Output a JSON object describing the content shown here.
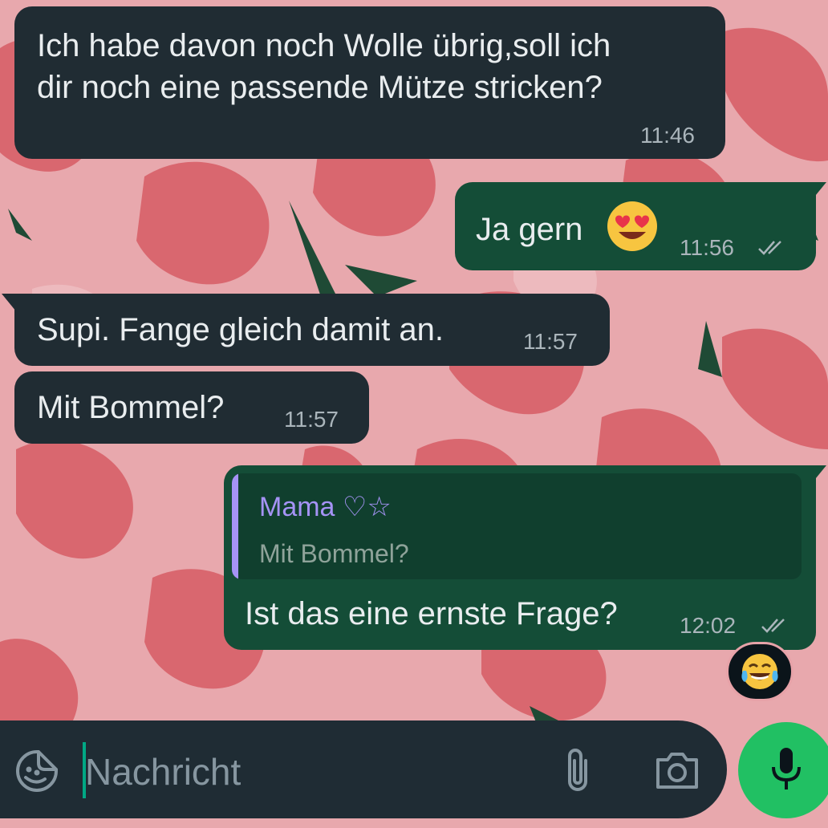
{
  "chat": {
    "messages": [
      {
        "direction": "incoming",
        "text_line1": "Ich habe davon noch Wolle übrig,soll ich",
        "text_line2": "dir noch eine passende Mütze stricken?",
        "time": "11:46"
      },
      {
        "direction": "outgoing",
        "text": "Ja gern",
        "emoji": "smiling-face-with-heart-eyes",
        "time": "11:56",
        "status": "read"
      },
      {
        "direction": "incoming",
        "text": "Supi. Fange gleich damit an.",
        "time": "11:57"
      },
      {
        "direction": "incoming",
        "text": "Mit Bommel?",
        "time": "11:57"
      },
      {
        "direction": "outgoing",
        "quote": {
          "author": "Mama ♡☆",
          "text": "Mit Bommel?"
        },
        "text": "Ist das eine ernste Frage?",
        "time": "12:02",
        "status": "read",
        "reaction": "face-with-tears-of-joy"
      }
    ]
  },
  "composer": {
    "placeholder": "Nachricht",
    "icons": [
      "sticker-icon",
      "paperclip-icon",
      "camera-icon",
      "microphone-icon"
    ]
  },
  "colors": {
    "incoming_bubble": "#202c33",
    "outgoing_bubble": "#144d37",
    "quote_accent": "#a593f5",
    "mic_button": "#21c063"
  }
}
